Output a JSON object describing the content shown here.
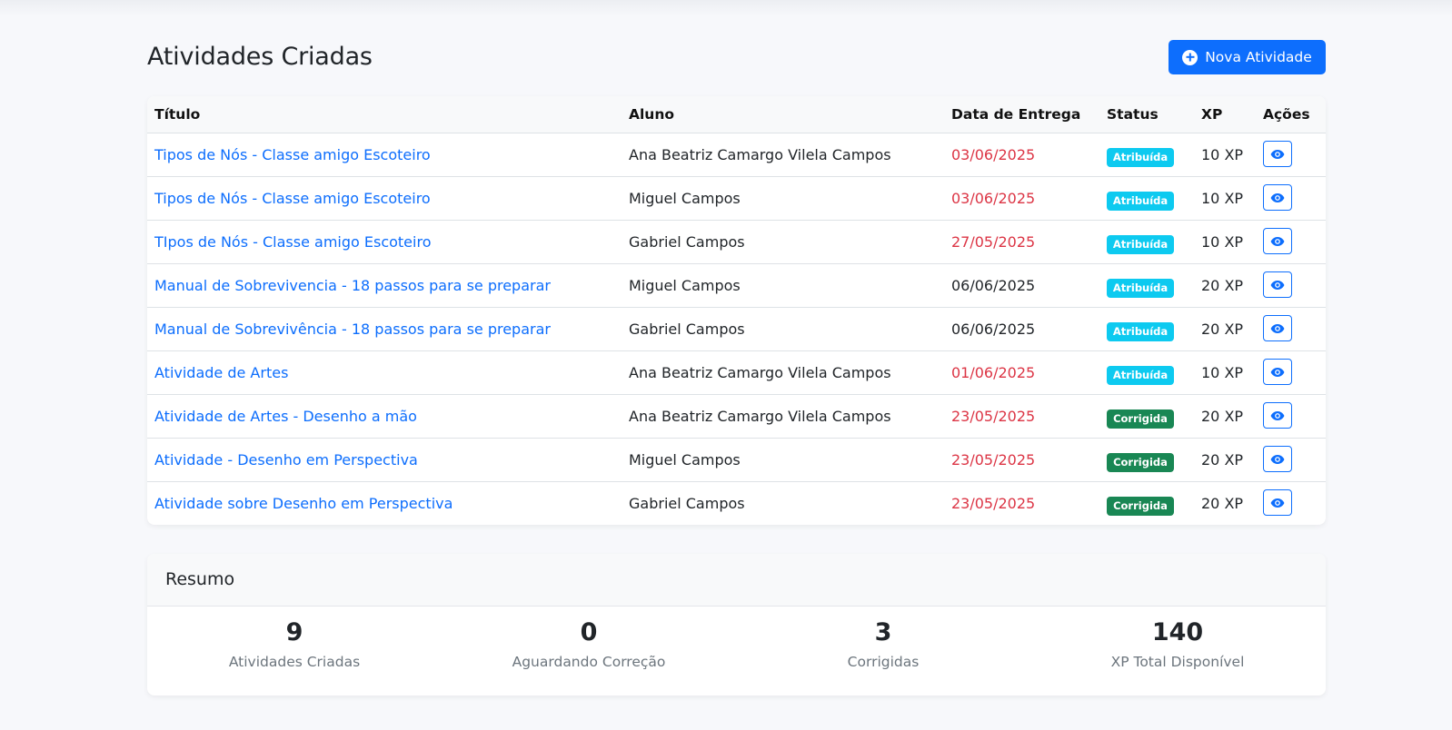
{
  "header": {
    "title": "Atividades Criadas",
    "new_button_label": "Nova Atividade"
  },
  "table": {
    "columns": {
      "title": "Título",
      "student": "Aluno",
      "due_date": "Data de Entrega",
      "status": "Status",
      "xp": "XP",
      "actions": "Ações"
    },
    "rows": [
      {
        "title": "Tipos de Nós - Classe amigo Escoteiro",
        "student": "Ana Beatriz Camargo Vilela Campos",
        "due_date": "03/06/2025",
        "late": true,
        "status": "Atribuída",
        "xp": "10 XP"
      },
      {
        "title": "Tipos de Nós - Classe amigo Escoteiro",
        "student": "Miguel Campos",
        "due_date": "03/06/2025",
        "late": true,
        "status": "Atribuída",
        "xp": "10 XP"
      },
      {
        "title": "TIpos de Nós - Classe amigo Escoteiro",
        "student": "Gabriel Campos",
        "due_date": "27/05/2025",
        "late": true,
        "status": "Atribuída",
        "xp": "10 XP"
      },
      {
        "title": "Manual de Sobrevivencia - 18 passos para se preparar",
        "student": "Miguel Campos",
        "due_date": "06/06/2025",
        "late": false,
        "status": "Atribuída",
        "xp": "20 XP"
      },
      {
        "title": "Manual de Sobrevivência - 18 passos para se preparar",
        "student": "Gabriel Campos",
        "due_date": "06/06/2025",
        "late": false,
        "status": "Atribuída",
        "xp": "20 XP"
      },
      {
        "title": "Atividade de Artes",
        "student": "Ana Beatriz Camargo Vilela Campos",
        "due_date": "01/06/2025",
        "late": true,
        "status": "Atribuída",
        "xp": "10 XP"
      },
      {
        "title": "Atividade de Artes - Desenho a mão",
        "student": "Ana Beatriz Camargo Vilela Campos",
        "due_date": "23/05/2025",
        "late": true,
        "status": "Corrigida",
        "xp": "20 XP"
      },
      {
        "title": "Atividade - Desenho em Perspectiva",
        "student": "Miguel Campos",
        "due_date": "23/05/2025",
        "late": true,
        "status": "Corrigida",
        "xp": "20 XP"
      },
      {
        "title": "Atividade sobre Desenho em Perspectiva",
        "student": "Gabriel Campos",
        "due_date": "23/05/2025",
        "late": true,
        "status": "Corrigida",
        "xp": "20 XP"
      }
    ],
    "view_icon": "eye-icon"
  },
  "summary": {
    "title": "Resumo",
    "stats": [
      {
        "value": "9",
        "label": "Atividades Criadas"
      },
      {
        "value": "0",
        "label": "Aguardando Correção"
      },
      {
        "value": "3",
        "label": "Corrigidas"
      },
      {
        "value": "140",
        "label": "XP Total Disponível"
      }
    ]
  },
  "colors": {
    "primary": "#0d6efd",
    "late_date": "#dc3545",
    "badge_assigned": "#0dcaf0",
    "badge_graded": "#198754",
    "muted": "#6c757d"
  }
}
